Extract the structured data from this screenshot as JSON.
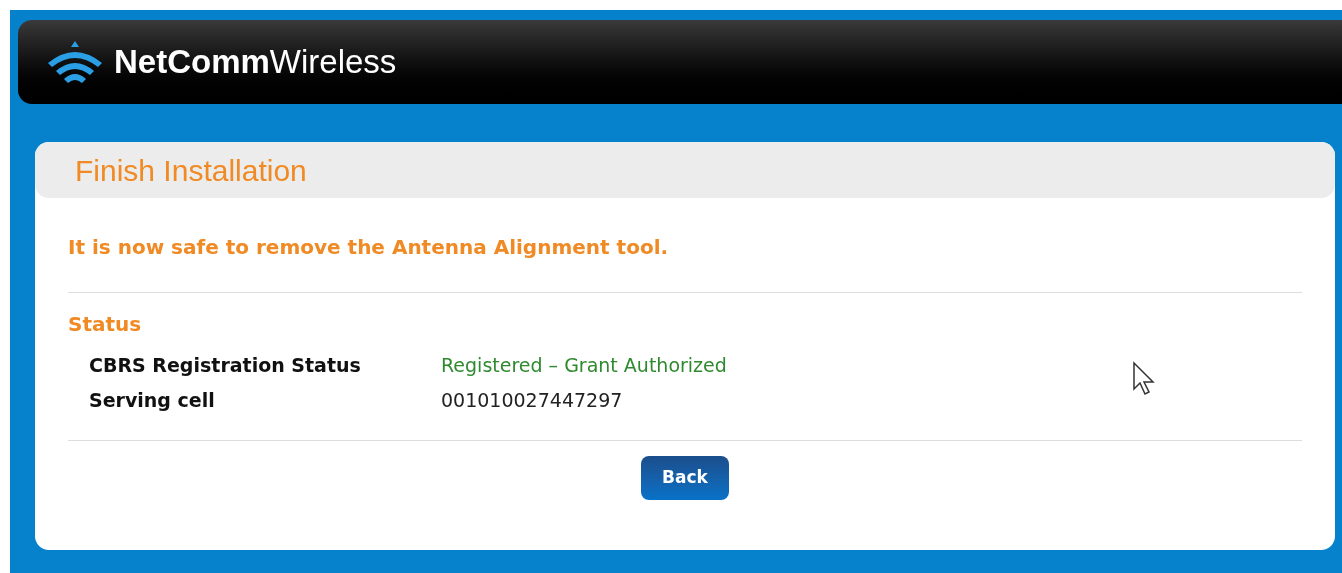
{
  "header": {
    "logo": "**NetComm**Wireless"
  },
  "page": {
    "title": "Finish Installation",
    "notice": "It is now safe to remove the Antenna Alignment tool.",
    "section": "Status",
    "rows": [
      {
        "label": "CBRS Registration Status",
        "value": "Registered – Grant Authorized",
        "kind": "status"
      },
      {
        "label": "Serving cell",
        "value": "001010027447297",
        "kind": "plain"
      }
    ],
    "button": "Back"
  }
}
